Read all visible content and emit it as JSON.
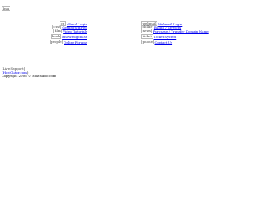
{
  "header": {
    "logo_alt": "Ima"
  },
  "left_links": [
    {
      "icon": "cp-icon",
      "icon_alt": "cp",
      "label": "cPanel Login"
    },
    {
      "icon": "cust-icon",
      "icon_alt": "cust",
      "label": "Getting Started"
    },
    {
      "icon": "film-icon",
      "icon_alt": "film",
      "label": "Video Tutorials"
    },
    {
      "icon": "book-icon",
      "icon_alt": "book",
      "label": "Knowledgebase"
    },
    {
      "icon": "people-icon",
      "icon_alt": "people",
      "label": "Online Forums"
    }
  ],
  "right_links": [
    {
      "icon": "webmail-icon",
      "icon_alt": "webmail",
      "label": "Webmail Login"
    },
    {
      "icon": "dollar-icon",
      "icon_alt": "dollar",
      "label": "Billing / Services"
    },
    {
      "icon": "news-icon",
      "icon_alt": "news",
      "label": "Purchase / Transfer Domain Name"
    },
    {
      "icon": "ticket-icon",
      "icon_alt": "ticket",
      "label": "Ticket System"
    },
    {
      "icon": "phone-icon",
      "icon_alt": "phone",
      "label": "Contact Us"
    }
  ],
  "footer": {
    "logo_alt": "Live Support",
    "link_text": "HostGator.com",
    "copyright": "Copyright 2006 © HostGator.com"
  }
}
